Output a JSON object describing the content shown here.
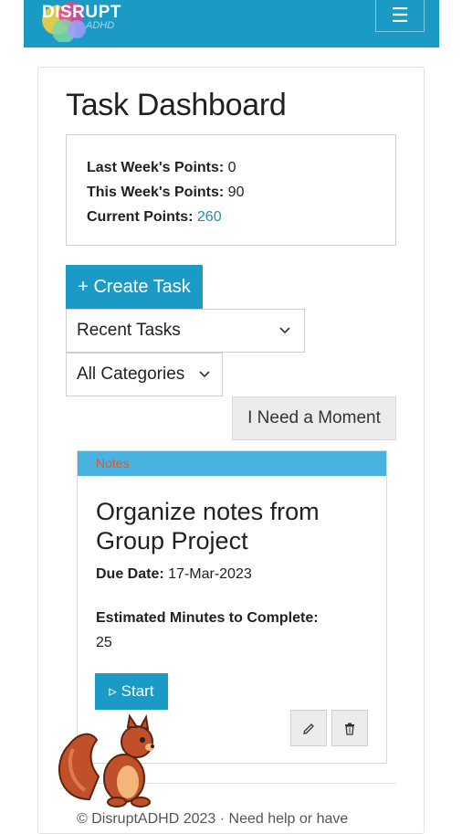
{
  "navbar": {
    "logo_text": "DISRUPT",
    "logo_sub": "ADHD",
    "menu_icon": "hamburger-menu-icon"
  },
  "page": {
    "title": "Task Dashboard"
  },
  "points": {
    "last_week_label": "Last Week's Points:",
    "last_week_value": "0",
    "this_week_label": "This Week's Points:",
    "this_week_value": "90",
    "current_label": "Current Points:",
    "current_value": "260"
  },
  "actions": {
    "create_task": "+ Create Task",
    "i_need_a_moment": "I Need a Moment"
  },
  "filters": {
    "task_view_selected": "Recent Tasks",
    "category_selected": "All Categories"
  },
  "task": {
    "category": "Notes",
    "title": "Organize notes from Group Project",
    "due_label": "Due Date:",
    "due_value": "17-Mar-2023",
    "estimate_label": "Estimated Minutes to Complete:",
    "estimate_value": "25",
    "start_label": "▹ Start",
    "edit_icon": "pencil-icon",
    "delete_icon": "trash-icon"
  },
  "footer": {
    "text": "© DisruptADHD 2023 · Need help or have"
  },
  "colors": {
    "primary": "#1a9ac4",
    "category_bar": "#48b2e0",
    "category_text": "#e0572a",
    "link": "#1a8fc0"
  }
}
